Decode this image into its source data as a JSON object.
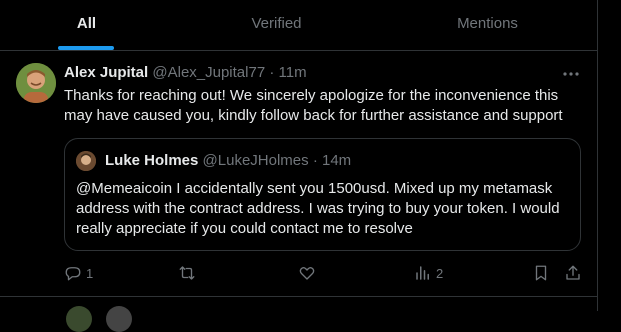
{
  "tabs": [
    {
      "label": "All",
      "active": true
    },
    {
      "label": "Verified",
      "active": false
    },
    {
      "label": "Mentions",
      "active": false
    }
  ],
  "tweet": {
    "name": "Alex Jupital",
    "handle": "@Alex_Jupital77",
    "dot": "·",
    "time": "11m",
    "text": "Thanks for reaching out! We sincerely apologize for the inconvenience this may have caused you, kindly follow back for further assistance and support",
    "quote": {
      "name": "Luke Holmes",
      "handle": "@LukeJHolmes",
      "dot": "·",
      "time": "14m",
      "text": "@Memeaicoin I accidentally sent you 1500usd. Mixed up my metamask address with the contract address. I was trying to buy your token. I would really appreciate if you could contact me to resolve"
    },
    "actions": {
      "reply_count": "1",
      "retweet_count": "",
      "like_count": "",
      "views_count": "2"
    }
  },
  "colors": {
    "background": "#000000",
    "text": "#e7e9ea",
    "muted": "#71767b",
    "accent": "#1d9bf0",
    "border": "#2f3336"
  },
  "icons": [
    "more-icon",
    "reply-icon",
    "retweet-icon",
    "like-icon",
    "views-icon",
    "bookmark-icon",
    "share-icon"
  ]
}
